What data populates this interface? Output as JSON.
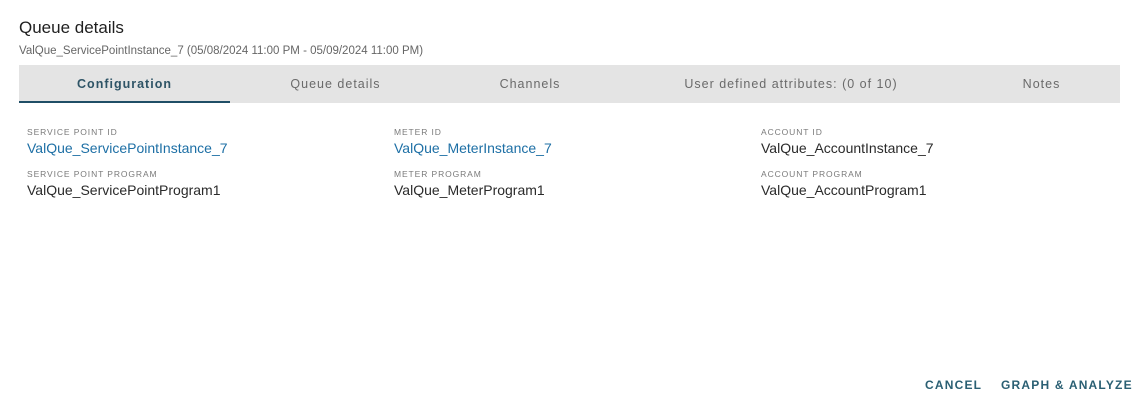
{
  "dialog": {
    "title": "Queue details",
    "subtitle": "ValQue_ServicePointInstance_7 (05/08/2024 11:00 PM - 05/09/2024 11:00 PM)"
  },
  "tabs": [
    {
      "label": "Configuration",
      "active": true
    },
    {
      "label": "Queue details",
      "active": false
    },
    {
      "label": "Channels",
      "active": false
    },
    {
      "label": "User defined attributes: (0 of 10)",
      "active": false
    },
    {
      "label": "Notes",
      "active": false
    }
  ],
  "fields": {
    "service_point_id": {
      "label": "SERVICE POINT ID",
      "value": "ValQue_ServicePointInstance_7"
    },
    "meter_id": {
      "label": "METER ID",
      "value": "ValQue_MeterInstance_7"
    },
    "account_id": {
      "label": "ACCOUNT ID",
      "value": "ValQue_AccountInstance_7"
    },
    "service_point_program": {
      "label": "SERVICE POINT PROGRAM",
      "value": "ValQue_ServicePointProgram1"
    },
    "meter_program": {
      "label": "METER PROGRAM",
      "value": "ValQue_MeterProgram1"
    },
    "account_program": {
      "label": "ACCOUNT PROGRAM",
      "value": "ValQue_AccountProgram1"
    }
  },
  "actions": {
    "cancel_label": "CANCEL",
    "graph_label": "GRAPH & ANALYZE"
  },
  "colors": {
    "accent": "#1f4e66",
    "link": "#1d6fa5",
    "tab_bar_bg": "#e4e4e4"
  }
}
